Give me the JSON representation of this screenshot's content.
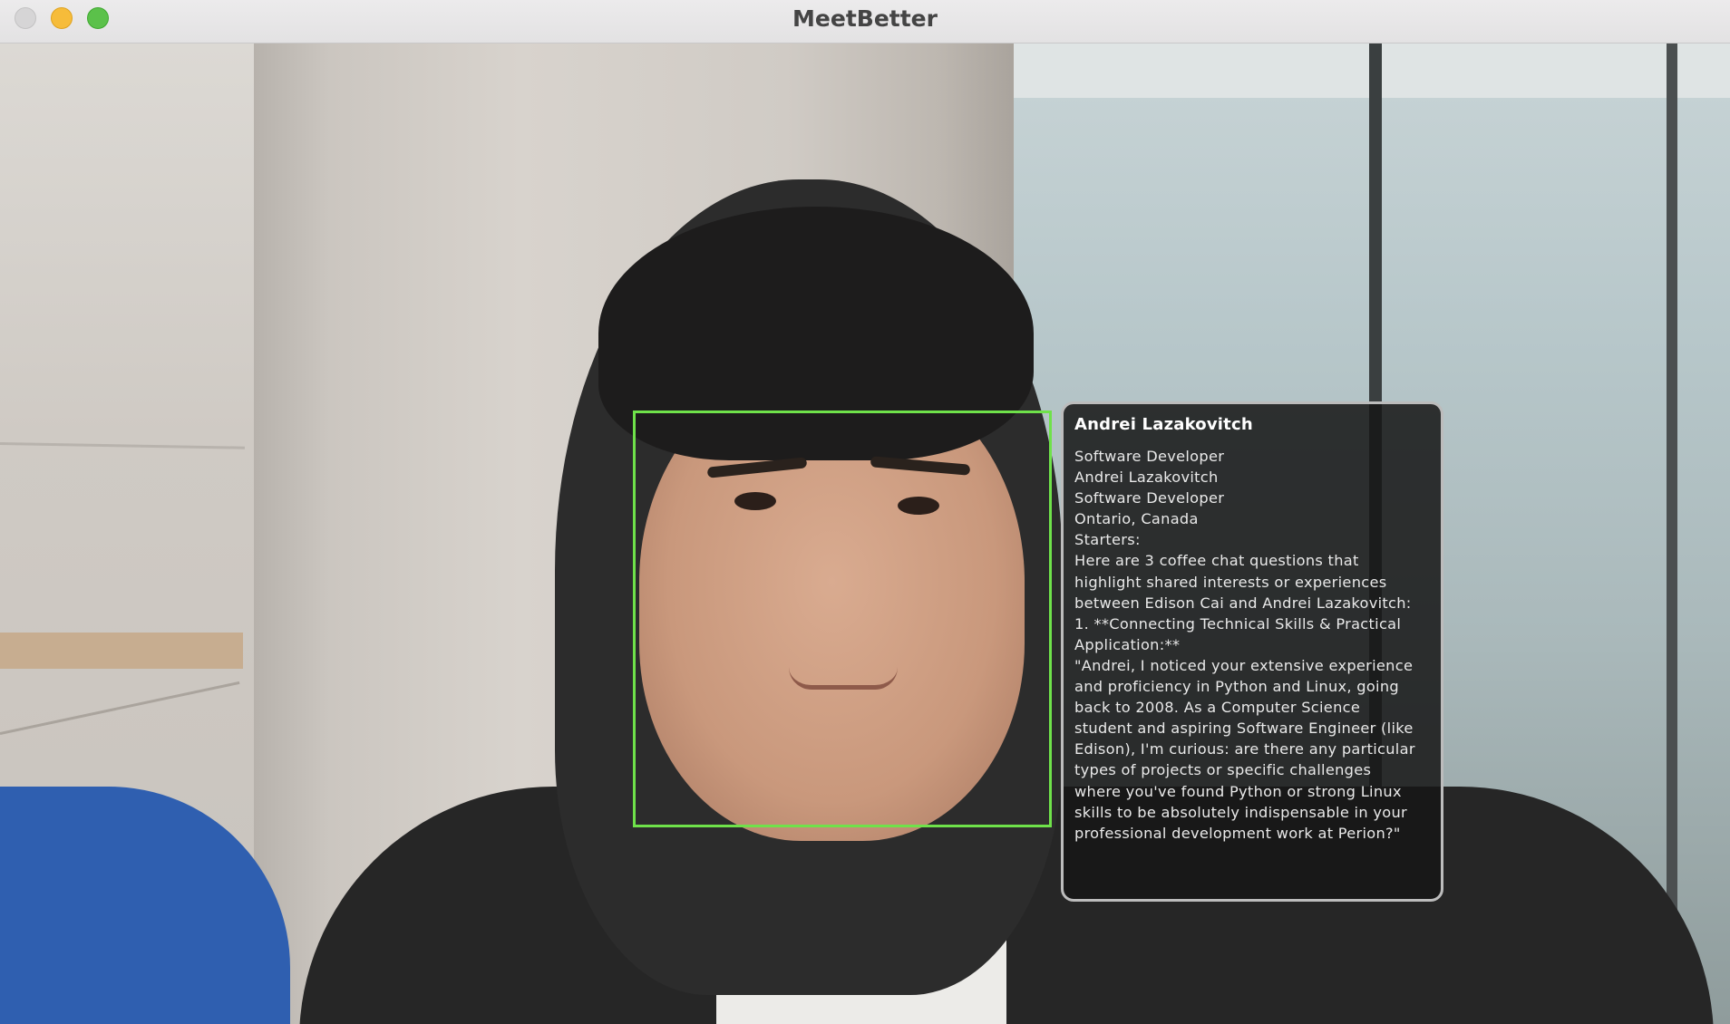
{
  "window": {
    "title": "MeetBetter"
  },
  "card": {
    "name": "Andrei Lazakovitch",
    "lines": [
      "Software Developer",
      "Andrei Lazakovitch",
      "Software Developer",
      "Ontario, Canada",
      "Starters:",
      "Here are 3 coffee chat questions that",
      "highlight shared interests or experiences",
      "between Edison Cai and Andrei Lazakovitch:",
      "1. **Connecting Technical Skills & Practical",
      "Application:**",
      "\"Andrei, I noticed your extensive experience",
      "and proficiency in Python and Linux, going",
      "back to 2008. As a Computer Science",
      "student and aspiring Software Engineer (like",
      "Edison), I'm curious: are there any particular",
      "types of projects or specific challenges",
      "where you've found Python or strong Linux",
      "skills to be absolutely indispensable in your",
      "professional development work at Perion?\""
    ]
  },
  "colors": {
    "face_box": "#6fe24a",
    "card_background": "#161616",
    "card_border": "#bcbcbc"
  },
  "icons": [
    "close-window-icon",
    "minimize-window-icon",
    "maximize-window-icon"
  ]
}
